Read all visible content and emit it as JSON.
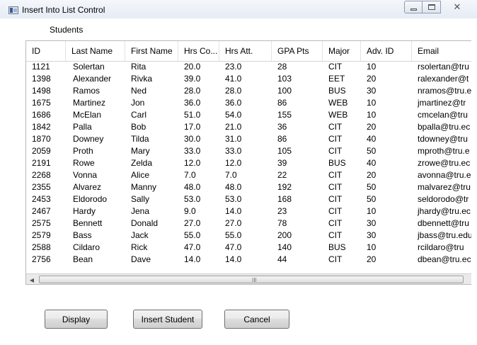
{
  "window": {
    "title": "Insert Into List Control",
    "controls": {
      "minimize": "",
      "maximize": "",
      "close": "✕"
    }
  },
  "group": {
    "label": "Students"
  },
  "table": {
    "columns": [
      "ID",
      "Last Name",
      "First Name",
      "Hrs Co...",
      "Hrs Att.",
      "GPA Pts",
      "Major",
      "Adv. ID",
      "Email"
    ],
    "rows": [
      [
        "1121",
        "Solertan",
        "Rita",
        "20.0",
        "23.0",
        "28",
        "CIT",
        "10",
        "rsolertan@tru"
      ],
      [
        "1398",
        "Alexander",
        "Rivka",
        "39.0",
        "41.0",
        "103",
        "EET",
        "20",
        "ralexander@t"
      ],
      [
        "1498",
        "Ramos",
        "Ned",
        "28.0",
        "28.0",
        "100",
        "BUS",
        "30",
        "nramos@tru.e"
      ],
      [
        "1675",
        "Martinez",
        "Jon",
        "36.0",
        "36.0",
        "86",
        "WEB",
        "10",
        "jmartinez@tr"
      ],
      [
        "1686",
        "McElan",
        "Carl",
        "51.0",
        "54.0",
        "155",
        "WEB",
        "10",
        "cmcelan@tru"
      ],
      [
        "1842",
        "Palla",
        "Bob",
        "17.0",
        "21.0",
        "36",
        "CIT",
        "20",
        "bpalla@tru.ec"
      ],
      [
        "1870",
        "Downey",
        "Tilda",
        "30.0",
        "31.0",
        "86",
        "CIT",
        "40",
        "tdowney@tru"
      ],
      [
        "2059",
        "Proth",
        "Mary",
        "33.0",
        "33.0",
        "105",
        "CIT",
        "50",
        "mproth@tru.e"
      ],
      [
        "2191",
        "Rowe",
        "Zelda",
        "12.0",
        "12.0",
        "39",
        "BUS",
        "40",
        "zrowe@tru.ec"
      ],
      [
        "2268",
        "Vonna",
        "Alice",
        "7.0",
        "7.0",
        "22",
        "CIT",
        "20",
        "avonna@tru.e"
      ],
      [
        "2355",
        "Alvarez",
        "Manny",
        "48.0",
        "48.0",
        "192",
        "CIT",
        "50",
        "malvarez@tru"
      ],
      [
        "2453",
        "Eldorodo",
        "Sally",
        "53.0",
        "53.0",
        "168",
        "CIT",
        "50",
        "seldorodo@tr"
      ],
      [
        "2467",
        "Hardy",
        "Jena",
        "9.0",
        "14.0",
        "23",
        "CIT",
        "10",
        "jhardy@tru.ec"
      ],
      [
        "2575",
        "Bennett",
        "Donald",
        "27.0",
        "27.0",
        "78",
        "CIT",
        "30",
        "dbennett@tru"
      ],
      [
        "2579",
        "Bass",
        "Jack",
        "55.0",
        "55.0",
        "200",
        "CIT",
        "30",
        "jbass@tru.edu"
      ],
      [
        "2588",
        "Cildaro",
        "Rick",
        "47.0",
        "47.0",
        "140",
        "BUS",
        "10",
        "rcildaro@tru"
      ],
      [
        "2756",
        "Bean",
        "Dave",
        "14.0",
        "14.0",
        "44",
        "CIT",
        "20",
        "dbean@tru.ec"
      ]
    ]
  },
  "scrollbar": {
    "left_arrow": "◀",
    "grip": "III"
  },
  "buttons": {
    "display": "Display",
    "insert": "Insert Student",
    "cancel": "Cancel"
  }
}
